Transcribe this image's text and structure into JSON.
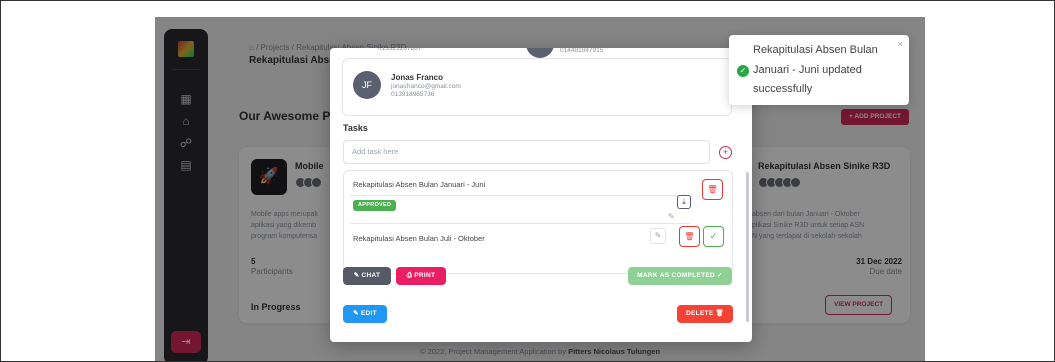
{
  "breadcrumb": {
    "home_icon": "home-icon",
    "path": "/ Projects / Rekapitulasi Absen Sinike R3D",
    "title": "Rekapitulasi Absen"
  },
  "sidebar": {
    "items": [
      "dashboard-icon",
      "briefcase-icon",
      "users-icon",
      "clipboard-icon"
    ],
    "logout_icon": "logout-icon"
  },
  "section": {
    "title": "Our Awesome Pro",
    "add_project": "+ ADD PROJECT"
  },
  "cards": {
    "left": {
      "title": "Mobile",
      "desc": [
        "Mobile apps merupak",
        "aplikasi yang dikemb",
        "program komputensa"
      ],
      "participants_count": "5",
      "participants_label": "Participants",
      "status": "In Progress"
    },
    "right": {
      "title": "Rekapitulasi Absen Sinike R3D",
      "desc": [
        "absen dari bulan Januari - Oktober",
        "plikasi Sinike R3D untuk setiap ASN",
        "N yang terdapat di sekolah-sekolah"
      ],
      "due": "31 Dec 2022",
      "due_label": "Due date",
      "view_button": "VIEW PROJECT"
    }
  },
  "footer": {
    "text": "© 2022, Project Management Application by",
    "author": "Pitters Nicolaus Tulungen"
  },
  "modal": {
    "contact_top_phone": "013321267867",
    "contact_top_phone_right": "014481047915",
    "contact": {
      "initials": "JF",
      "name": "Jonas Franco",
      "email": "jonasfranco@gmail.com",
      "phone": "013918965736"
    },
    "tasks_title": "Tasks",
    "task_input_placeholder": "Add task here",
    "tasks": [
      {
        "label": "Rekapitulasi Absen Bulan Januari - Juni",
        "badge": "APPROVED"
      },
      {
        "label": "Rekapitulasi Absen Bulan Juli - Oktober"
      }
    ],
    "buttons": {
      "chat": "✎ CHAT",
      "print": "⎙ PRINT",
      "complete": "MARK AS COMPLETED ✓",
      "edit": "✎ EDIT",
      "delete": "DELETE 🗑"
    }
  },
  "toast": {
    "line1": "Rekapitulasi Absen Bulan",
    "line2": "Januari - Juni updated",
    "line3": "successfully",
    "close": "×"
  },
  "colors": {
    "accent": "#d3285a",
    "success": "#4caf50",
    "danger": "#f44336",
    "info": "#2196f3"
  }
}
